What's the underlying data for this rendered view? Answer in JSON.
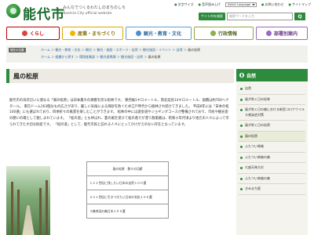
{
  "header": {
    "logo_text": "能代市",
    "tagline": "みんなでつくるわたしのまちのしろ",
    "subtag": "Noshiro City official website",
    "util_links": [
      "文字サイズ",
      "音声読み上げ",
      "Select Language",
      "お問い合わせ",
      "サイトマップ"
    ],
    "lang_select": "Select Language",
    "site_button": "サイト内を検索",
    "search_placeholder": "検索ワードを入力",
    "search_button": "Q"
  },
  "nav": {
    "items": [
      {
        "label": "くらし"
      },
      {
        "label": "産業・まちづくり"
      },
      {
        "label": "観光・教育・文化"
      },
      {
        "label": "行政情報"
      },
      {
        "label": "部署別案内"
      }
    ]
  },
  "breadcrumb": {
    "label": "現在の位置",
    "line1": [
      "ホーム",
      "観光・教育・文化",
      "観光",
      "観光・施設・スポーツ・自然",
      "観光施設・イベント",
      "自然",
      "風の松原"
    ],
    "line2": [
      "ホーム",
      "組織から探す",
      "環境産業部",
      "観光振興課",
      "観光施設・自然",
      "風の松原"
    ]
  },
  "main": {
    "title": "風の松原",
    "intro": [
      "能代市の海岸沿いに連なる「風の松原」は日本最大の規模を誇る松林です。",
      "東西幅1キロメートル、南北延長14キロメートル、面積は約760ヘクタール。",
      "東京ドーム163個分もの広さがあり、厳しい気候による飛砂を防ぐため江戸時代から植林され続けてきました。",
      "平成8年には「日本の松100選」にも選ばれており、四季折々の風景を楽しむことができます。",
      "松林の中には遊歩道やジョギングコースが整備されており、市民や観光客の憩いの場として親しまれています。",
      "「松の道」とも呼ばれ、夏の風を受けて松の香りが漂う散策路は、昭和十年代頃より地元の人々によって守られてきた大切な財産です。",
      "「松の道」として、能代市民と訪れる人々にとってかけがえのない存在となっています。"
    ],
    "table": {
      "header": "風の松原　数々の功績",
      "rows": [
        "１２１世紀に残したい日本の自然１００選",
        "２２１世紀に引きつぎたい日本の名松１００選",
        "３森林浴の森日本１００選"
      ]
    }
  },
  "sidebar": {
    "heading": "自然",
    "items": [
      "自然",
      "風が吹く日の松林",
      "風が吹く日の森における新型コロナウイルス感染症対策",
      "風が吹く日の松原",
      "風の松原",
      "ふたつい神楽",
      "ふたつい神楽の森",
      "七座天神大杉",
      "ふたつい神楽の森",
      "きみまち阪"
    ],
    "active_index": 4
  }
}
